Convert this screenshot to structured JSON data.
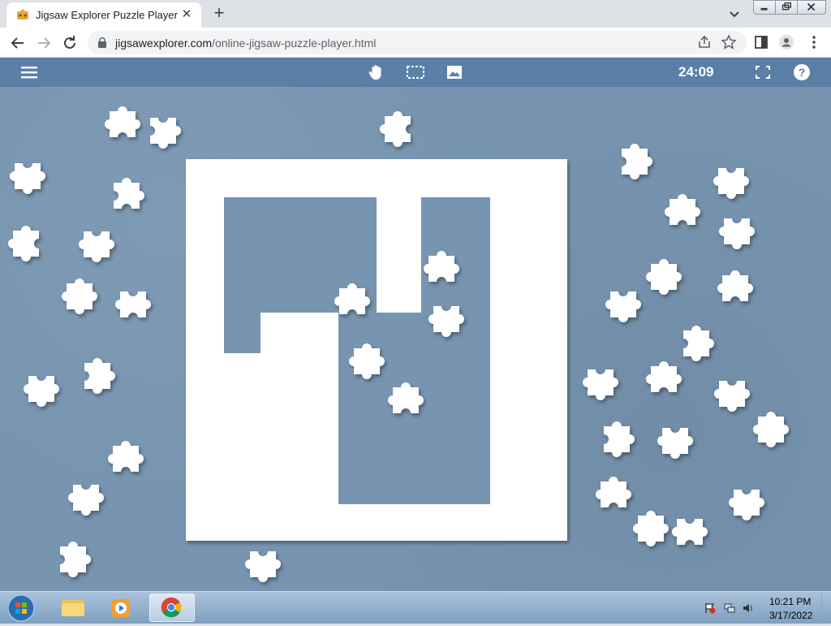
{
  "browser": {
    "tab_title": "Jigsaw Explorer Puzzle Player",
    "close_tab": "✕",
    "new_tab": "+",
    "url_domain": "jigsawexplorer.com",
    "url_path": "/online-jigsaw-puzzle-player.html"
  },
  "app": {
    "timer": "24:09",
    "toolbar_icons": [
      "menu-icon",
      "hand-icon",
      "select-icon",
      "image-icon",
      "fullscreen-icon",
      "help-icon"
    ],
    "theme_color": "#5a80a7",
    "table_color": "#7794b0",
    "piece_color": "#ffffff"
  },
  "taskbar": {
    "time": "10:21 PM",
    "date": "3/17/2022",
    "apps": [
      "explorer",
      "media-player",
      "chrome"
    ]
  }
}
